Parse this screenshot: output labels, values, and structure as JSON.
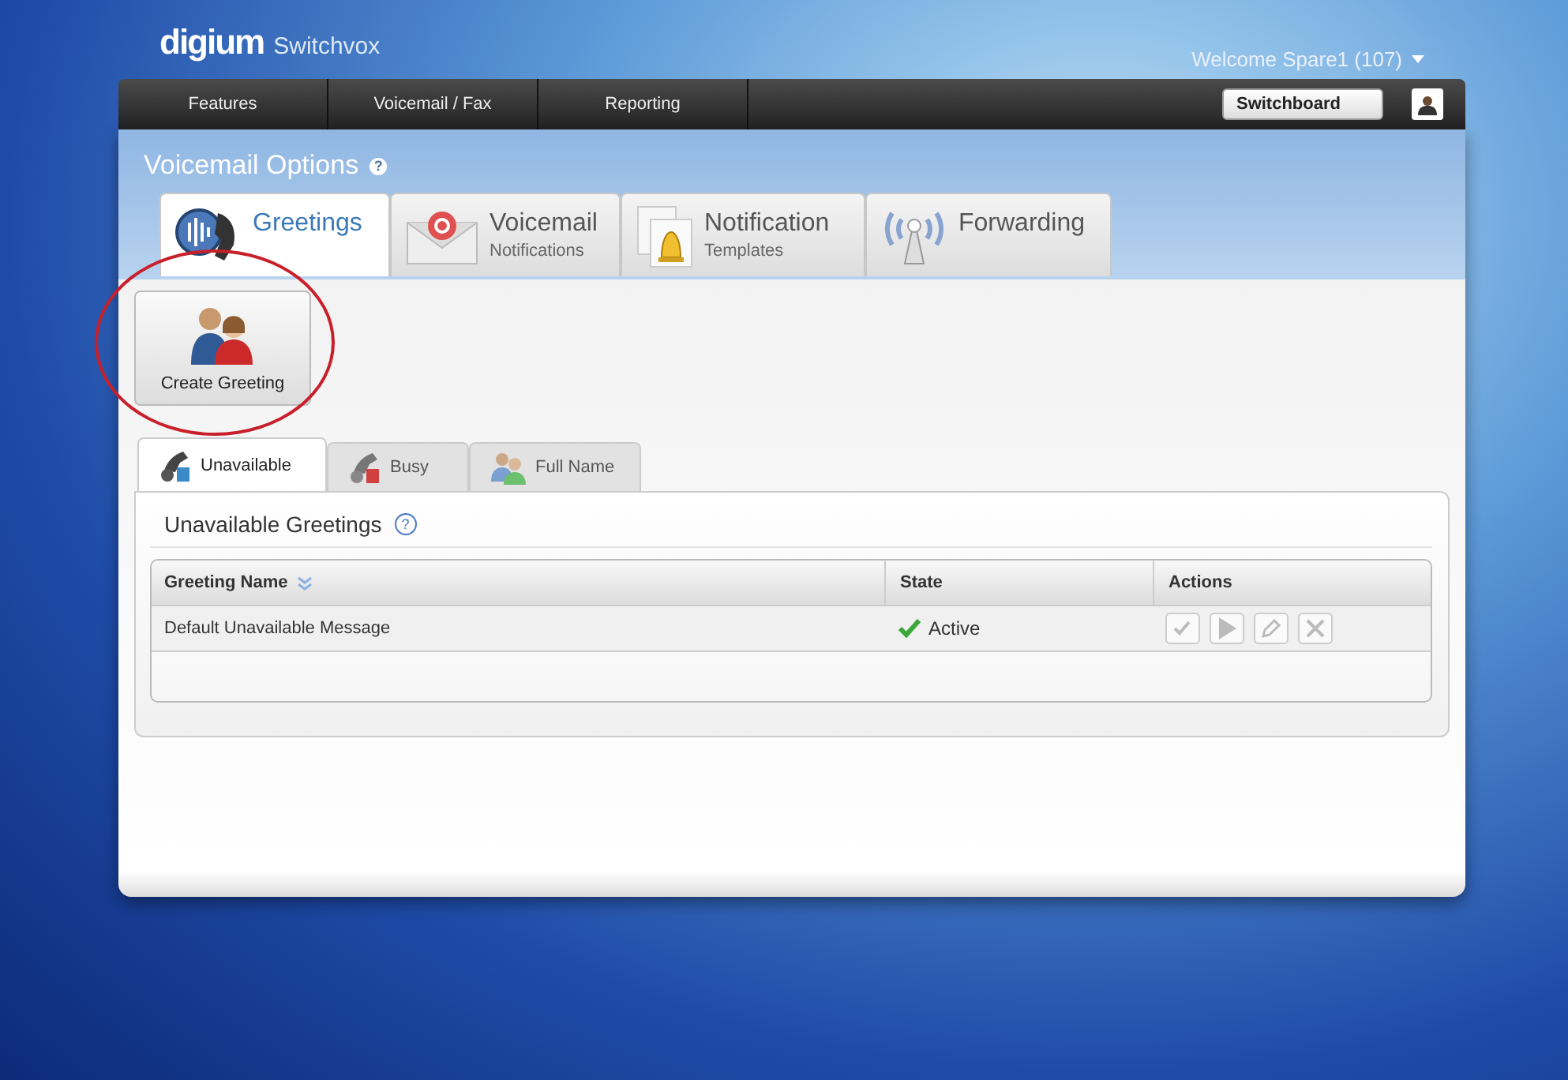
{
  "header": {
    "logo": "digium",
    "product": "Switchvox",
    "welcome": "Welcome Spare1 (107)"
  },
  "nav": {
    "items": [
      {
        "label": "Features",
        "selected": false
      },
      {
        "label": "Voicemail / Fax",
        "selected": false
      },
      {
        "label": "Reporting",
        "selected": false
      }
    ],
    "switchboard": "Switchboard"
  },
  "page_title": "Voicemail Options",
  "page_title_help": "?",
  "main_tabs": [
    {
      "kind": "greetings",
      "title": "Greetings",
      "selected": true
    },
    {
      "kind": "voicemail",
      "title": "Voicemail",
      "subtitle": "Notifications",
      "selected": false
    },
    {
      "kind": "notification",
      "title": "Notification",
      "subtitle": "Templates",
      "selected": false
    },
    {
      "kind": "forwarding",
      "title": "Forwarding",
      "selected": false
    }
  ],
  "create_button": "Create Greeting",
  "sub_tabs": [
    {
      "kind": "unavailable",
      "label": "Unavailable",
      "selected": true
    },
    {
      "kind": "busy",
      "label": "Busy",
      "selected": false
    },
    {
      "kind": "fullname",
      "label": "Full Name",
      "selected": false
    }
  ],
  "section_title": "Unavailable Greetings",
  "section_help": "?",
  "table": {
    "columns": [
      "Greeting Name",
      "State",
      "Actions"
    ],
    "rows": [
      {
        "greeting_name": "Default Unavailable Message",
        "state": "Active",
        "active": true,
        "actions_disabled": true
      }
    ]
  }
}
